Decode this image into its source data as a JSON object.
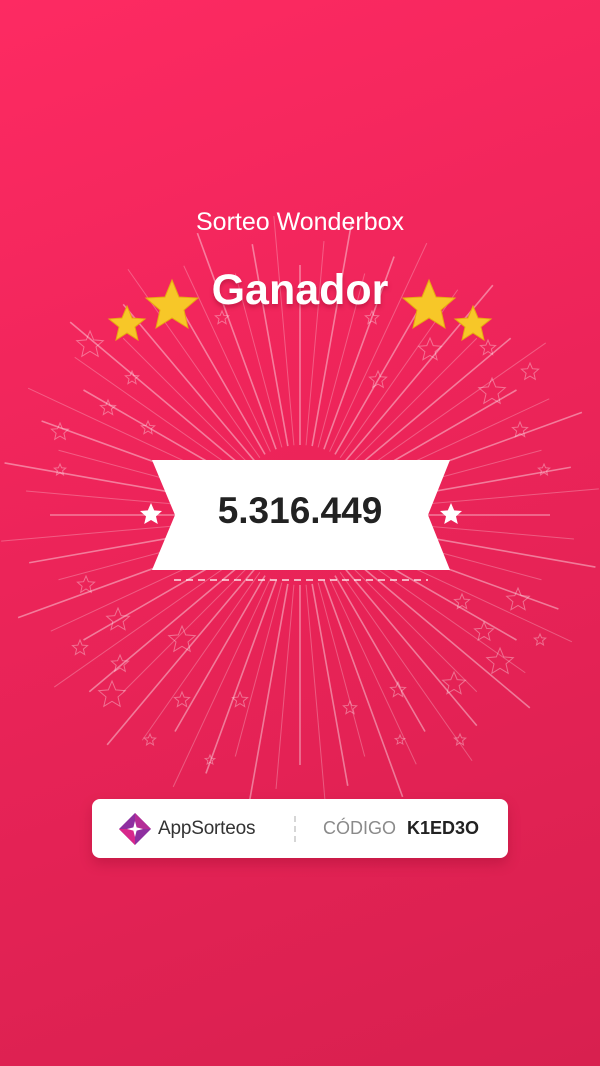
{
  "header": {
    "title": "Sorteo Wonderbox",
    "subtitle": "Ganador"
  },
  "winner": {
    "number": "5.316.449"
  },
  "footer_card": {
    "brand_prefix": "App",
    "brand_suffix": "Sorteos",
    "code_label": "CÓDIGO",
    "code_value": "K1ED3O"
  },
  "colors": {
    "background_top": "#fd2a62",
    "background_bottom": "#d8204f",
    "star_gold": "#f7c728",
    "logo_purple": "#8e2fa0",
    "logo_magenta": "#d8278b"
  },
  "icons": [
    "gold-star-icon",
    "white-star-icon",
    "appsorteos-logo-icon"
  ]
}
